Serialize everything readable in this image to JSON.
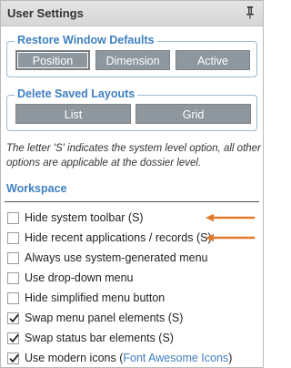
{
  "window": {
    "title": "User Settings"
  },
  "restore_defaults": {
    "legend": "Restore Window Defaults",
    "buttons": [
      {
        "label": "Position",
        "selected": true
      },
      {
        "label": "Dimension",
        "selected": false
      },
      {
        "label": "Active",
        "selected": false
      }
    ]
  },
  "delete_layouts": {
    "legend": "Delete Saved Layouts",
    "buttons": [
      {
        "label": "List"
      },
      {
        "label": "Grid"
      }
    ]
  },
  "note": "The letter 'S' indicates the system level option, all other options are applicable at the dossier level.",
  "workspace": {
    "title": "Workspace",
    "options": [
      {
        "label": "Hide system toolbar (S)",
        "checked": false
      },
      {
        "label": "Hide recent applications / records (S)",
        "checked": false
      },
      {
        "label": "Always use system-generated menu",
        "checked": false
      },
      {
        "label": "Use drop-down menu",
        "checked": false
      },
      {
        "label": "Hide simplified menu button",
        "checked": false
      },
      {
        "label": "Swap menu panel elements (S)",
        "checked": true
      },
      {
        "label": "Swap status bar elements (S)",
        "checked": true
      },
      {
        "label": "Use modern icons (",
        "link": "Font Awesome Icons",
        "suffix": ")",
        "checked": true
      }
    ]
  },
  "colors": {
    "accent": "#3f7fc1",
    "button": "#8f979e",
    "annotation_arrow": "#e07a2e"
  },
  "icons": {
    "pin": "pin-icon",
    "check": "checkmark-icon",
    "arrow": "arrow-left-icon"
  }
}
